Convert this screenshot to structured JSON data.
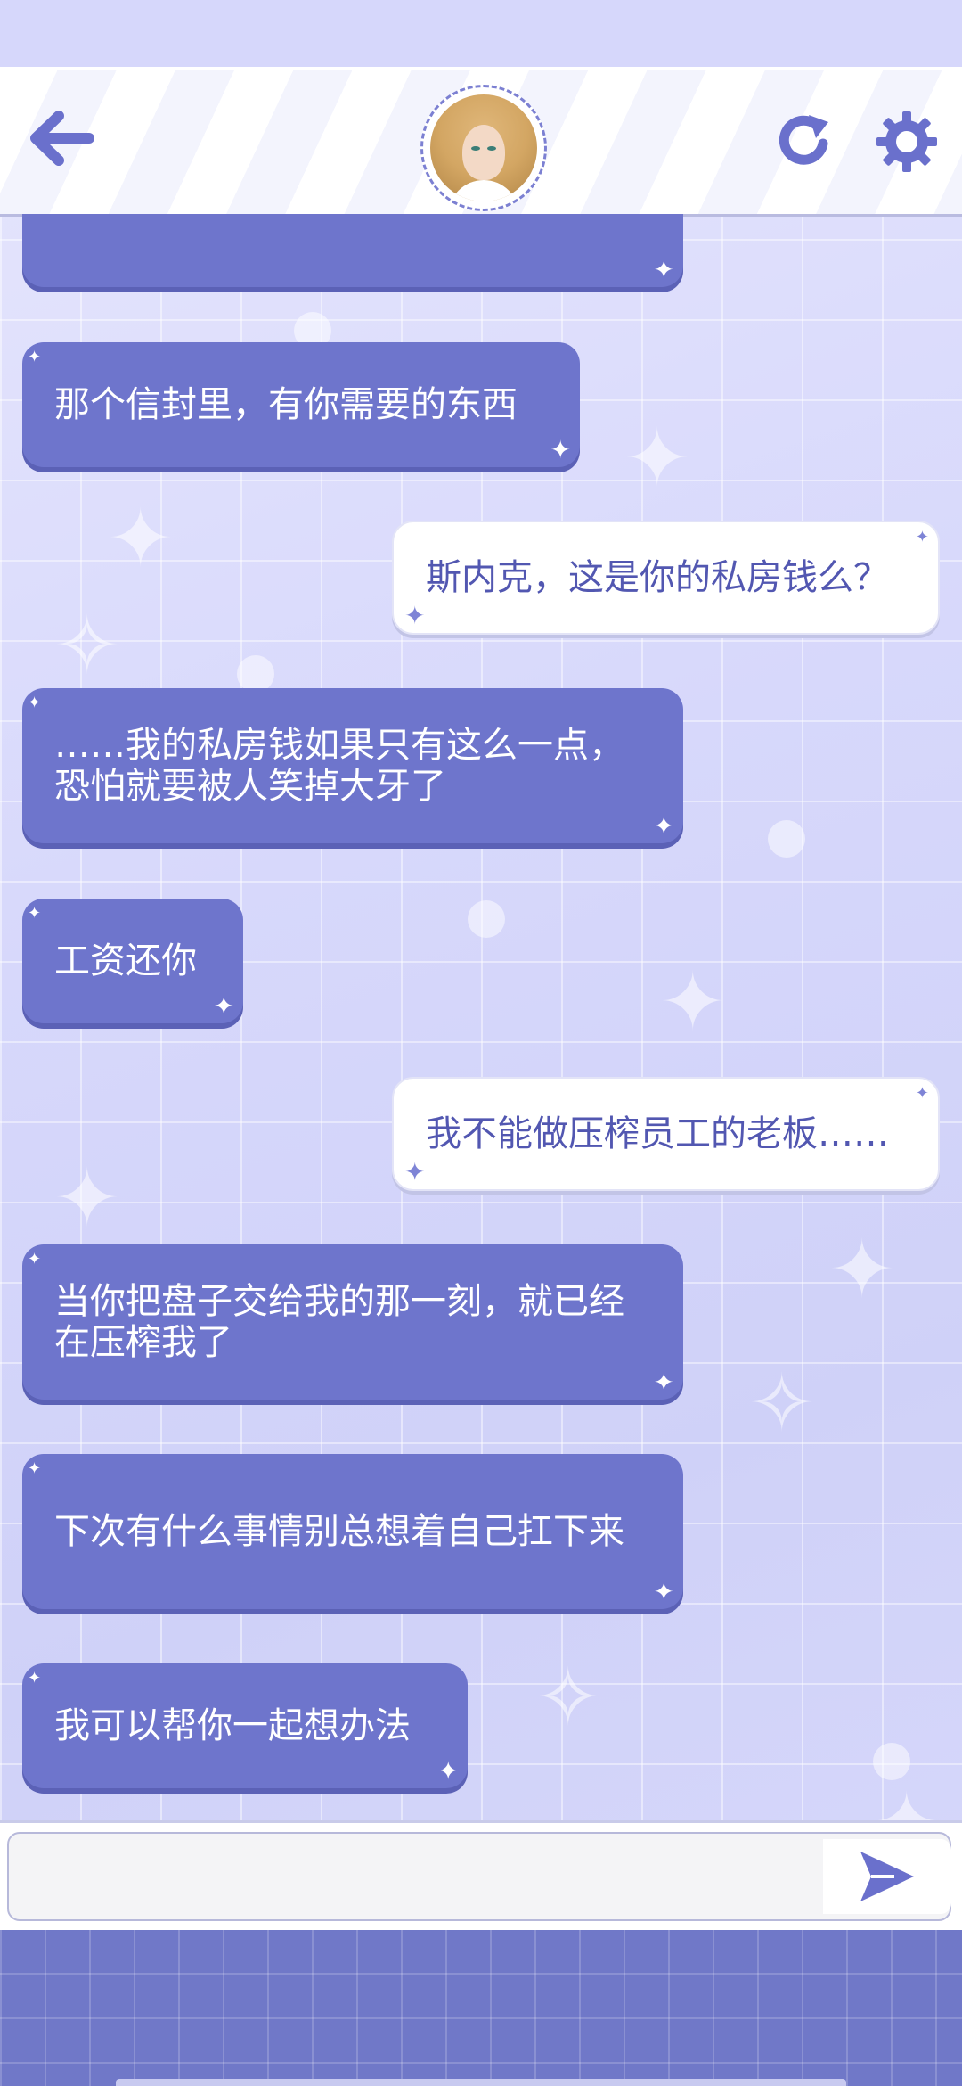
{
  "header": {
    "back_icon": "arrow-left-icon",
    "avatar_alt": "avatar",
    "refresh_icon": "refresh-icon",
    "settings_icon": "gear-icon"
  },
  "colors": {
    "accent": "#6e75cc",
    "outgoing_text": "#5257b1",
    "background": "#dfe0fb"
  },
  "messages": [
    {
      "direction": "in",
      "text": ""
    },
    {
      "direction": "in",
      "text": "那个信封里，有你需要的东西"
    },
    {
      "direction": "out",
      "text": "斯内克，这是你的私房钱么？"
    },
    {
      "direction": "in",
      "text": "……我的私房钱如果只有这么一点，恐怕就要被人笑掉大牙了"
    },
    {
      "direction": "in",
      "text": "工资还你"
    },
    {
      "direction": "out",
      "text": "我不能做压榨员工的老板……"
    },
    {
      "direction": "in",
      "text": "当你把盘子交给我的那一刻，就已经在压榨我了"
    },
    {
      "direction": "in",
      "text": "下次有什么事情别总想着自己扛下来"
    },
    {
      "direction": "in",
      "text": "我可以帮你一起想办法"
    }
  ],
  "composer": {
    "value": "",
    "placeholder": "",
    "send_icon": "send-icon"
  }
}
